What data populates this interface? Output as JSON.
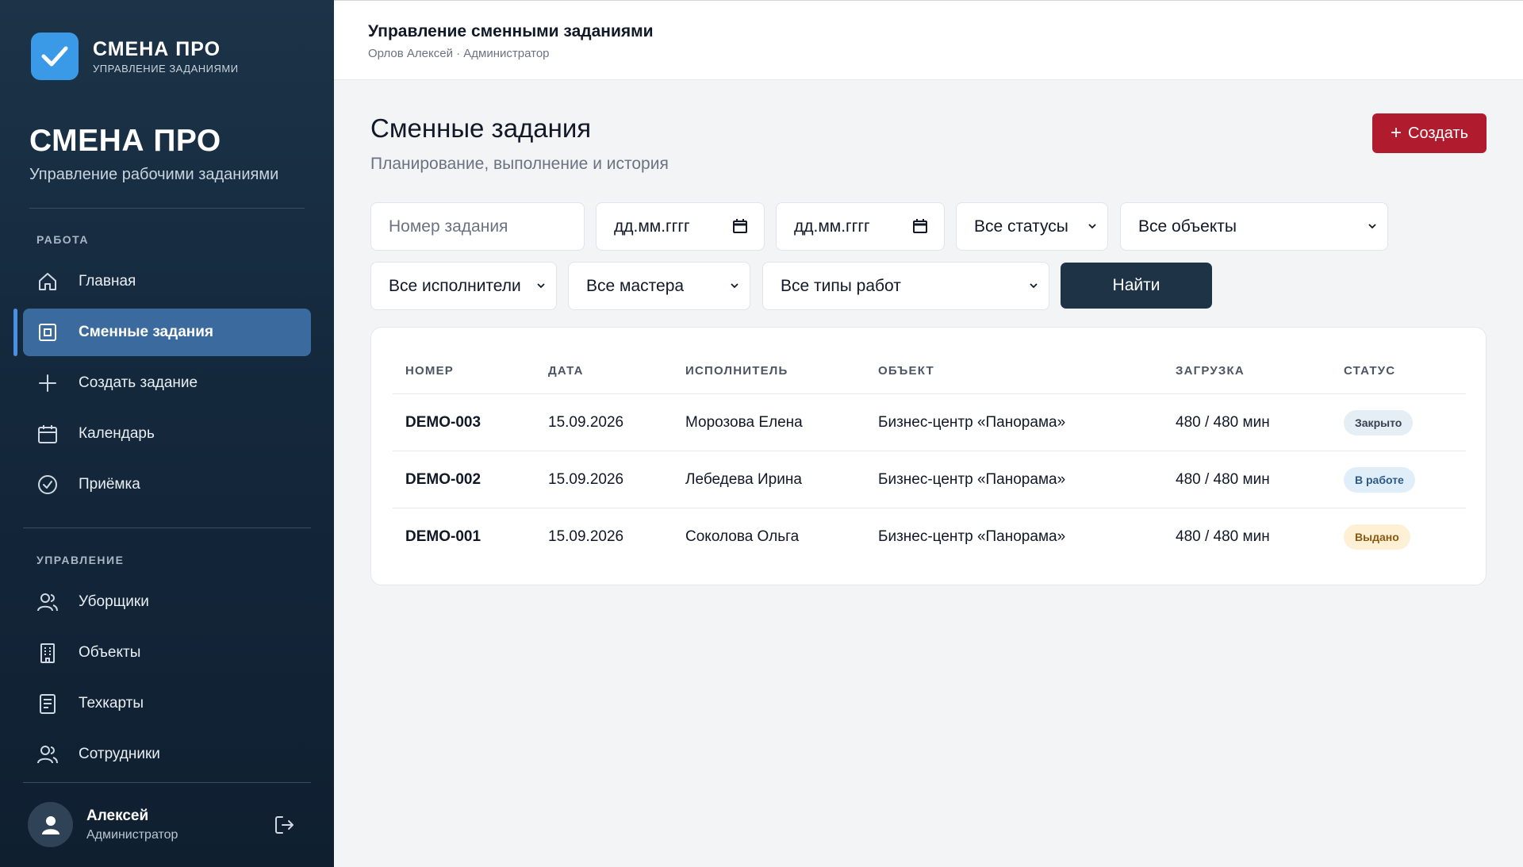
{
  "brand": {
    "name": "СМЕНА ПРО",
    "subtitle": "УПРАВЛЕНИЕ ЗАДАНИЯМИ"
  },
  "sidebar": {
    "title": "СМЕНА ПРО",
    "subtitle": "Управление рабочими заданиями",
    "sections": [
      {
        "label": "РАБОТА",
        "items": [
          {
            "label": "Главная",
            "icon": "home-icon"
          },
          {
            "label": "Сменные задания",
            "icon": "square-icon",
            "active": true
          },
          {
            "label": "Создать задание",
            "icon": "plus-icon"
          },
          {
            "label": "Календарь",
            "icon": "calendar-icon"
          },
          {
            "label": "Приёмка",
            "icon": "check-circle-icon"
          }
        ]
      },
      {
        "label": "УПРАВЛЕНИЕ",
        "items": [
          {
            "label": "Уборщики",
            "icon": "users-icon"
          },
          {
            "label": "Объекты",
            "icon": "building-icon"
          },
          {
            "label": "Техкарты",
            "icon": "document-icon"
          },
          {
            "label": "Сотрудники",
            "icon": "users-icon"
          }
        ]
      }
    ],
    "user": {
      "name": "Алексей",
      "role": "Администратор"
    }
  },
  "header": {
    "title": "Управление сменными заданиями",
    "subtitle": "Орлов Алексей · Администратор"
  },
  "main": {
    "title": "Сменные задания",
    "subtitle": "Планирование, выполнение и история",
    "create_label": "Создать",
    "filters": {
      "task_number_placeholder": "Номер задания",
      "date_from": "дд.мм.гггг",
      "date_to": "дд.мм.гггг",
      "status": "Все статусы",
      "objects": "Все объекты",
      "executors": "Все исполнители",
      "masters": "Все мастера",
      "work_types": "Все типы работ",
      "search_label": "Найти"
    },
    "table": {
      "columns": [
        "НОМЕР",
        "ДАТА",
        "ИСПОЛНИТЕЛЬ",
        "ОБЪЕКТ",
        "ЗАГРУЗКА",
        "СТАТУС"
      ],
      "rows": [
        {
          "number": "DEMO-003",
          "date": "15.09.2026",
          "executor": "Морозова Елена",
          "object": "Бизнес-центр «Панорама»",
          "load": "480 / 480 мин",
          "status": "Закрыто",
          "status_bg": "#e5edf5",
          "status_color": "#374151"
        },
        {
          "number": "DEMO-002",
          "date": "15.09.2026",
          "executor": "Лебедева Ирина",
          "object": "Бизнес-центр «Панорама»",
          "load": "480 / 480 мин",
          "status": "В работе",
          "status_bg": "#e0eefa",
          "status_color": "#2c5a85"
        },
        {
          "number": "DEMO-001",
          "date": "15.09.2026",
          "executor": "Соколова Ольга",
          "object": "Бизнес-центр «Панорама»",
          "load": "480 / 480 мин",
          "status": "Выдано",
          "status_bg": "#fdf0d5",
          "status_color": "#8a5a12"
        }
      ]
    }
  },
  "colors": {
    "sidebar": "#1c3348",
    "accent": "#3a6a9e",
    "create": "#b01c2e",
    "search": "#1f3347"
  }
}
